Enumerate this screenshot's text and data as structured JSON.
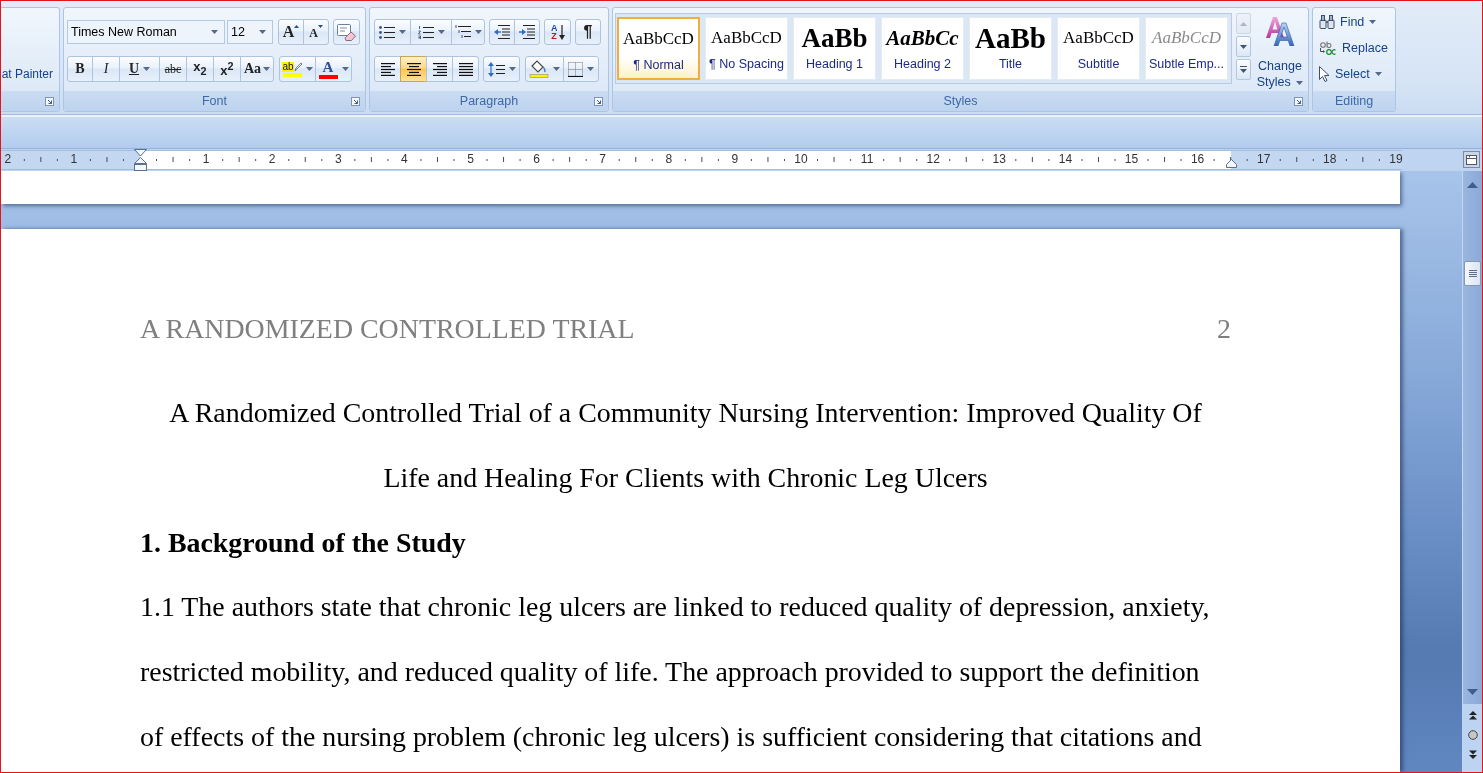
{
  "ribbon": {
    "clipboard_group": {
      "button_label": "at Painter"
    },
    "font_group": {
      "label": "Font",
      "font_name": "Times New Roman",
      "font_size": "12",
      "size_buttons": [
        {
          "label": "A",
          "kind": "grow"
        },
        {
          "label": "A",
          "kind": "shrink"
        }
      ],
      "format_buttons": [
        {
          "label": "B",
          "kind": "bold",
          "dropdown": false
        },
        {
          "label": "I",
          "kind": "italic",
          "dropdown": false
        },
        {
          "label": "U",
          "kind": "underline",
          "dropdown": true
        },
        {
          "label": "abc",
          "kind": "strike",
          "dropdown": false
        },
        {
          "label": "x$_{2}$",
          "kind": "subscript",
          "dropdown": false
        },
        {
          "label": "x$^{2}$",
          "kind": "superscript",
          "dropdown": false
        },
        {
          "label": "Aa",
          "kind": "case",
          "dropdown": true
        }
      ],
      "highlight_button": {
        "label": "ab"
      },
      "font_color_button": {
        "label": "A"
      }
    },
    "paragraph_group": {
      "label": "Paragraph",
      "sort_button": {
        "label_top": "A",
        "label_bottom": "Z"
      },
      "show_hide_button": {
        "label": "¶"
      },
      "alignment_buttons": [
        {
          "kind": "left",
          "selected": false
        },
        {
          "kind": "center",
          "selected": true
        },
        {
          "kind": "right",
          "selected": false
        },
        {
          "kind": "justify",
          "selected": false
        }
      ]
    },
    "styles_group": {
      "label": "Styles",
      "gallery": [
        {
          "preview": "AaBbCcD",
          "name": "¶ Normal",
          "kind": "normal",
          "selected": true
        },
        {
          "preview": "AaBbCcD",
          "name": "¶ No Spacing",
          "kind": "nospacing",
          "selected": false
        },
        {
          "preview": "AaBb",
          "name": "Heading 1",
          "kind": "heading1",
          "selected": false
        },
        {
          "preview": "AaBbCc",
          "name": "Heading 2",
          "kind": "heading2",
          "selected": false
        },
        {
          "preview": "AaBb",
          "name": "Title",
          "kind": "title",
          "selected": false
        },
        {
          "preview": "AaBbCcD",
          "name": "Subtitle",
          "kind": "subtitle",
          "selected": false
        },
        {
          "preview": "AaBbCcD",
          "name": "Subtle Emp...",
          "kind": "subtle",
          "selected": false
        }
      ],
      "gallery_up_button": {
        "disabled": true
      },
      "change_styles_button": {
        "label": "Change Styles"
      }
    },
    "editing_group": {
      "label": "Editing",
      "buttons": [
        {
          "label": "Find",
          "kind": "find",
          "dropdown": true
        },
        {
          "label": "Replace",
          "kind": "replace",
          "dropdown": false
        },
        {
          "label": "Select",
          "kind": "select",
          "dropdown": true
        }
      ]
    }
  },
  "ruler": {
    "left_numbers": [
      "2",
      "1"
    ],
    "numbers": [
      "1",
      "2",
      "3",
      "4",
      "5",
      "6",
      "7",
      "8",
      "9",
      "10",
      "11",
      "12",
      "13",
      "14",
      "15",
      "16",
      "17",
      "18",
      "19"
    ]
  },
  "document": {
    "page": {
      "header_title": "A RANDOMIZED CONTROLLED TRIAL",
      "page_number": "2",
      "title": "A Randomized Controlled Trial of a Community Nursing Intervention: Improved Quality Of Life and Healing For Clients with Chronic Leg Ulcers",
      "heading": "1. Background of the Study",
      "paragraph": "1.1 The authors state that chronic leg ulcers are linked to reduced quality of depression, anxiety, restricted mobility, and reduced quality of life. The approach provided to support the definition of effects of the nursing problem (chronic leg ulcers) is sufficient considering that citations and"
    }
  }
}
